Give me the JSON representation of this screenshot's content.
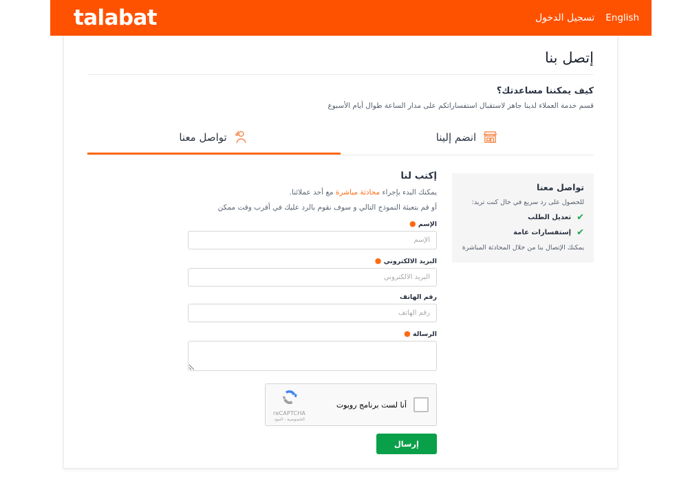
{
  "header": {
    "logo_text": "talabat",
    "login_label": "تسجيل الدخول",
    "language_label": "English",
    "background_color": "#ff5200"
  },
  "page": {
    "title": "إتصل بنا",
    "help_heading": "كيف يمكننا مساعدتك؟",
    "help_subtext": "قسم خدمة العملاء لدينا جاهز لاستقبال استفساراتكم على مدار الساعة طوال أيام الأسبوع"
  },
  "tabs": [
    {
      "label": "تواصل معنا",
      "icon": "customer-service-agent-icon",
      "active": true
    },
    {
      "label": "انضم إلينا",
      "icon": "storefront-icon",
      "active": false
    }
  ],
  "form": {
    "heading": "إكتب لنا",
    "para1_before": "يمكنك البدء بإجراء ",
    "para1_link": "محادثة مباشرة",
    "para1_after": " مع أحد عملائنا.",
    "para2": "أو قم بتعبئة النموذج التالي و سوف نقوم بالرد عليك في أقرب وقت ممكن",
    "fields": [
      {
        "label": "الإسم",
        "placeholder": "الإسم",
        "required": true,
        "type": "text"
      },
      {
        "label": "البريد الالكتروني",
        "placeholder": "البريد الالكتروني",
        "required": true,
        "type": "text"
      },
      {
        "label": "رقم الهاتف",
        "placeholder": "رقم الهاتف",
        "required": false,
        "type": "text"
      },
      {
        "label": "الرسالة",
        "placeholder": "",
        "required": true,
        "type": "textarea"
      }
    ],
    "required_marker": "*",
    "submit_label": "إرسال"
  },
  "recaptcha": {
    "checkbox_label": "أنا لست برنامج روبوت",
    "brand_name": "reCAPTCHA",
    "terms_text": "الخصوصية - البنود"
  },
  "info_box": {
    "title": "تواصل معنا",
    "subtitle": "للحصول على رد سريع في حال كنت تريد:",
    "items": [
      {
        "text": "تعديل الطلب",
        "icon": "check-icon"
      },
      {
        "text": "إستفسارات عامة",
        "icon": "check-icon"
      }
    ],
    "footer": "يمكنك الإتصال بنا من خلال المحادثة المباشرة"
  },
  "colors": {
    "brand_orange": "#ff5200",
    "tab_orange": "#ff6a13",
    "check_green": "#1aa64b",
    "submit_green": "#0aa04a"
  }
}
